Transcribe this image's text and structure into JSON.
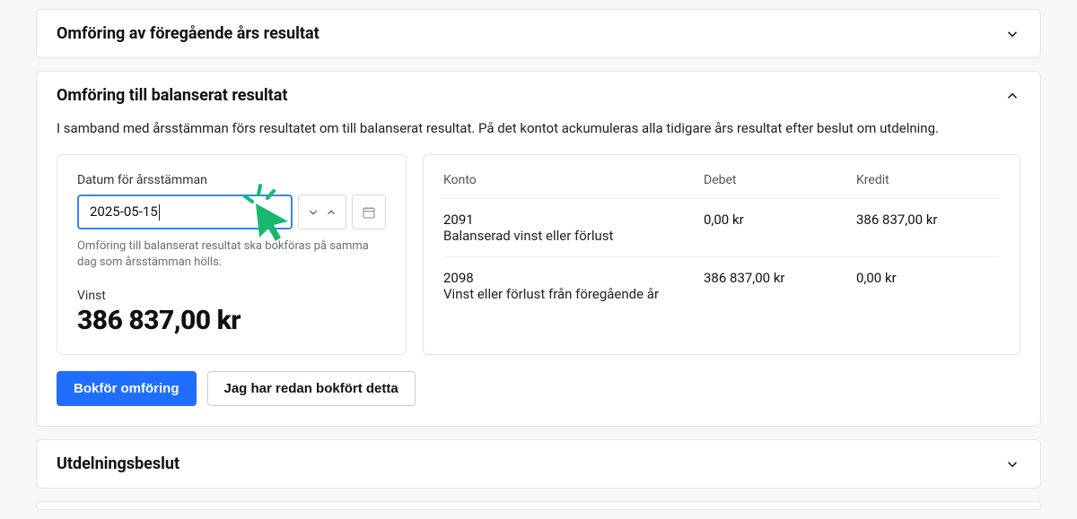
{
  "panel1": {
    "title": "Omföring av föregående års resultat"
  },
  "panel2": {
    "title": "Omföring till balanserat resultat",
    "description": "I samband med årsstämman förs resultatet om till balanserat resultat. På det kontot ackumuleras alla tidigare års resultat efter beslut om utdelning.",
    "date_label": "Datum för årsstämman",
    "date_value": "2025-05-15",
    "helper": "Omföring till balanserat resultat ska bokföras på samma dag som årsstämman hölls.",
    "vinst_label": "Vinst",
    "vinst_value": "386 837,00 kr",
    "table": {
      "head_konto": "Konto",
      "head_debet": "Debet",
      "head_kredit": "Kredit",
      "rows": [
        {
          "code": "2091",
          "name": "Balanserad vinst eller förlust",
          "debet": "0,00 kr",
          "kredit": "386 837,00 kr"
        },
        {
          "code": "2098",
          "name": "Vinst eller förlust från föregående år",
          "debet": "386 837,00 kr",
          "kredit": "0,00 kr"
        }
      ]
    },
    "btn_primary": "Bokför omföring",
    "btn_secondary": "Jag har redan bokfört detta"
  },
  "panel3": {
    "title": "Utdelningsbeslut"
  }
}
